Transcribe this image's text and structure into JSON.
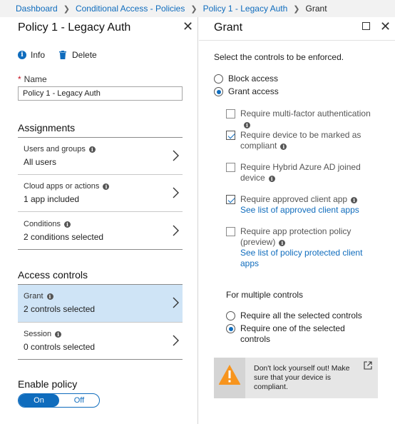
{
  "breadcrumb": {
    "items": [
      "Dashboard",
      "Conditional Access - Policies",
      "Policy 1 - Legacy Auth"
    ],
    "current": "Grant"
  },
  "left_blade": {
    "title": "Policy 1 - Legacy Auth",
    "toolbar": {
      "info_label": "Info",
      "delete_label": "Delete"
    },
    "name": {
      "label": "Name",
      "value": "Policy 1 - Legacy Auth"
    },
    "assignments": {
      "heading": "Assignments",
      "rows": [
        {
          "label": "Users and groups",
          "value": "All users"
        },
        {
          "label": "Cloud apps or actions",
          "value": "1 app included"
        },
        {
          "label": "Conditions",
          "value": "2 conditions selected"
        }
      ]
    },
    "access_controls": {
      "heading": "Access controls",
      "rows": [
        {
          "label": "Grant",
          "value": "2 controls selected",
          "selected": true
        },
        {
          "label": "Session",
          "value": "0 controls selected",
          "selected": false
        }
      ]
    },
    "enable_policy": {
      "label": "Enable policy",
      "on": "On",
      "off": "Off",
      "value": "On"
    }
  },
  "right_blade": {
    "title": "Grant",
    "intro": "Select the controls to be enforced.",
    "mode_options": [
      {
        "label": "Block access",
        "checked": false
      },
      {
        "label": "Grant access",
        "checked": true
      }
    ],
    "controls": [
      {
        "label": "Require multi-factor authentication",
        "checked": false
      },
      {
        "label": "Require device to be marked as compliant",
        "checked": true
      },
      {
        "label": "Require Hybrid Azure AD joined device",
        "checked": false
      },
      {
        "label": "Require approved client app",
        "checked": true,
        "link": "See list of approved client apps"
      },
      {
        "label": "Require app protection policy (preview)",
        "checked": false,
        "link": "See list of policy protected client apps"
      }
    ],
    "multiple_controls": {
      "heading": "For multiple controls",
      "options": [
        {
          "label": "Require all the selected controls",
          "checked": false
        },
        {
          "label": "Require one of the selected controls",
          "checked": true
        }
      ]
    },
    "warning": {
      "message": "Don't lock yourself out! Make sure that your device is compliant."
    }
  },
  "colors": {
    "accent": "#0f6cbd",
    "warning": "#f7941d",
    "selected_row": "#cfe4f6"
  }
}
